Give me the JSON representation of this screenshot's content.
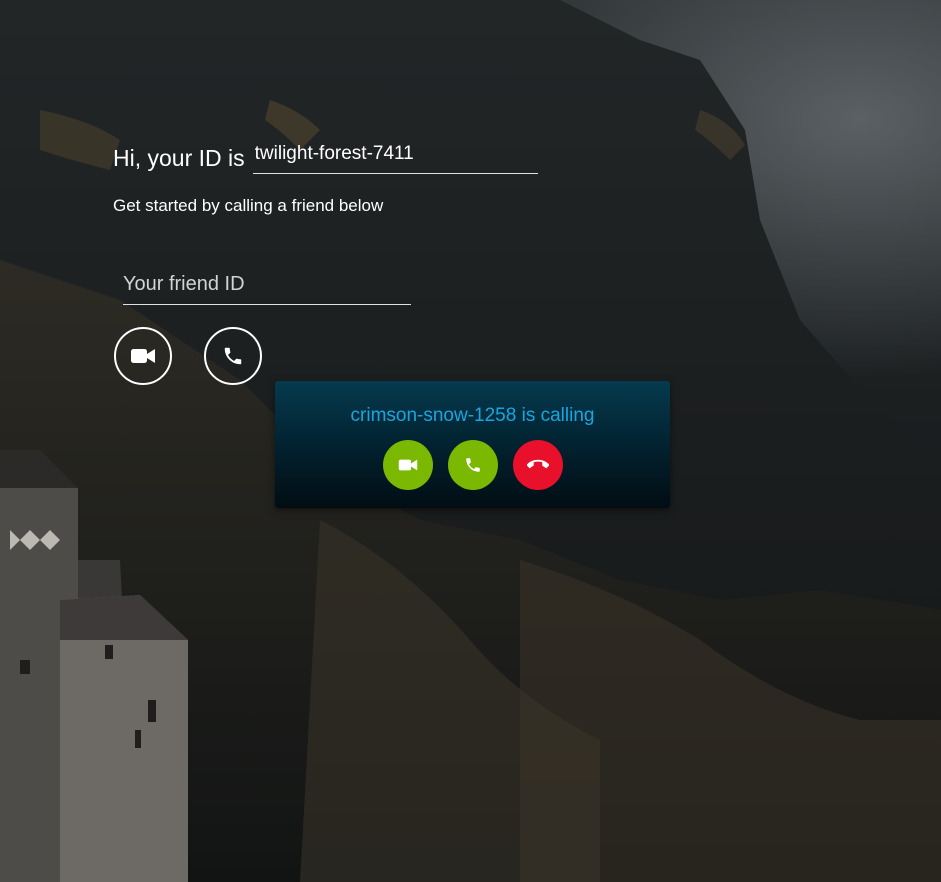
{
  "greeting": {
    "prefix": "Hi, your ID is",
    "client_id": "twilight-forest-7411"
  },
  "subtitle": "Get started by calling a friend below",
  "friend_input": {
    "placeholder": "Your friend ID",
    "value": ""
  },
  "actions": {
    "video_icon": "video-camera-icon",
    "audio_icon": "phone-icon"
  },
  "incoming_call": {
    "message": "crimson-snow-1258 is calling",
    "accept_video_icon": "video-camera-icon",
    "accept_audio_icon": "phone-icon",
    "reject_icon": "phone-hangup-icon"
  },
  "colors": {
    "accept": "#7bb802",
    "reject": "#e8102a",
    "call_text": "#17a6df"
  }
}
